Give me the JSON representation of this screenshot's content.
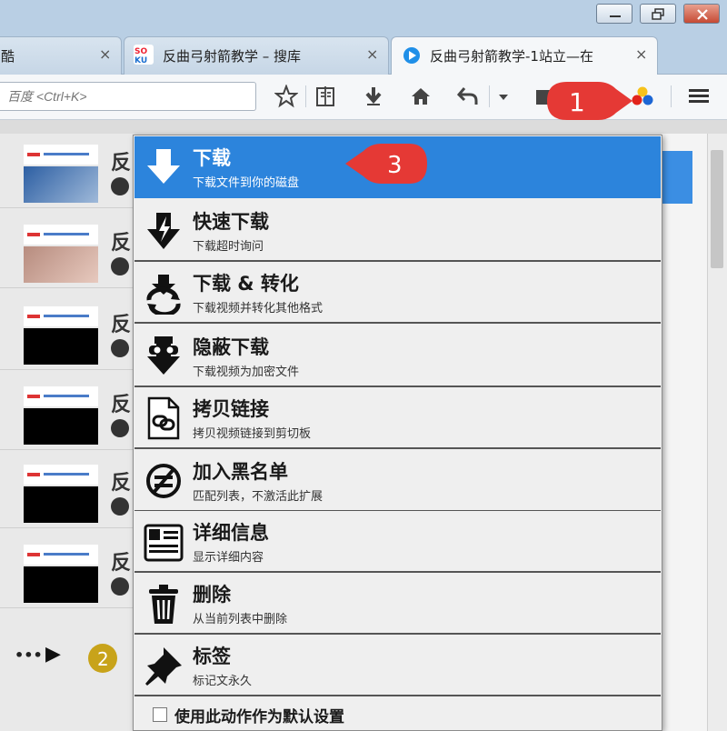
{
  "window": {
    "minimize_icon": "minimize-icon",
    "restore_icon": "restore-icon",
    "close_icon": "close-icon"
  },
  "tabs": [
    {
      "label": "酷",
      "close": "×"
    },
    {
      "label": "反曲弓射箭教学 – 搜库",
      "close": "×",
      "favicon": "soku-icon"
    },
    {
      "label": "反曲弓射箭教学-1站立—在",
      "close": "×",
      "favicon": "play-icon"
    }
  ],
  "new_tab": "+",
  "search": {
    "placeholder": "百度 <Ctrl+K>"
  },
  "callouts": {
    "toolbar": "1",
    "menu": "3",
    "list": "2"
  },
  "list_items": [
    {
      "char": "反",
      "thumb": "face"
    },
    {
      "char": "反",
      "thumb": "kid"
    },
    {
      "char": "反",
      "thumb": "black"
    },
    {
      "char": "反",
      "thumb": "black"
    },
    {
      "char": "反",
      "thumb": "black"
    },
    {
      "char": "反",
      "thumb": "black"
    }
  ],
  "player": {
    "more": "•••",
    "play": "▶"
  },
  "menu": {
    "items": [
      {
        "label": "下载",
        "sub": "下载文件到你的磁盘",
        "icon": "download-arrow-icon",
        "selected": true
      },
      {
        "label": "快速下载",
        "sub": "下载超时询问",
        "icon": "fast-download-icon"
      },
      {
        "label": "下载 & 转化",
        "sub": "下载视频并转化其他格式",
        "icon": "convert-download-icon"
      },
      {
        "label": "隐蔽下载",
        "sub": "下载视频为加密文件",
        "icon": "stealth-download-icon"
      },
      {
        "label": "拷贝链接",
        "sub": "拷贝视频链接到剪切板",
        "icon": "copy-link-icon"
      },
      {
        "label": "加入黑名单",
        "sub": "匹配列表，不激活此扩展",
        "icon": "blacklist-icon"
      },
      {
        "label": "详细信息",
        "sub": "显示详细内容",
        "icon": "details-icon"
      },
      {
        "label": "删除",
        "sub": "从当前列表中删除",
        "icon": "trash-icon"
      },
      {
        "label": "标签",
        "sub": "标记文永久",
        "icon": "pin-icon"
      }
    ],
    "default_label": "使用此动作作为默认设置"
  },
  "colors": {
    "accent": "#2c84dc",
    "callout": "#e53935"
  }
}
